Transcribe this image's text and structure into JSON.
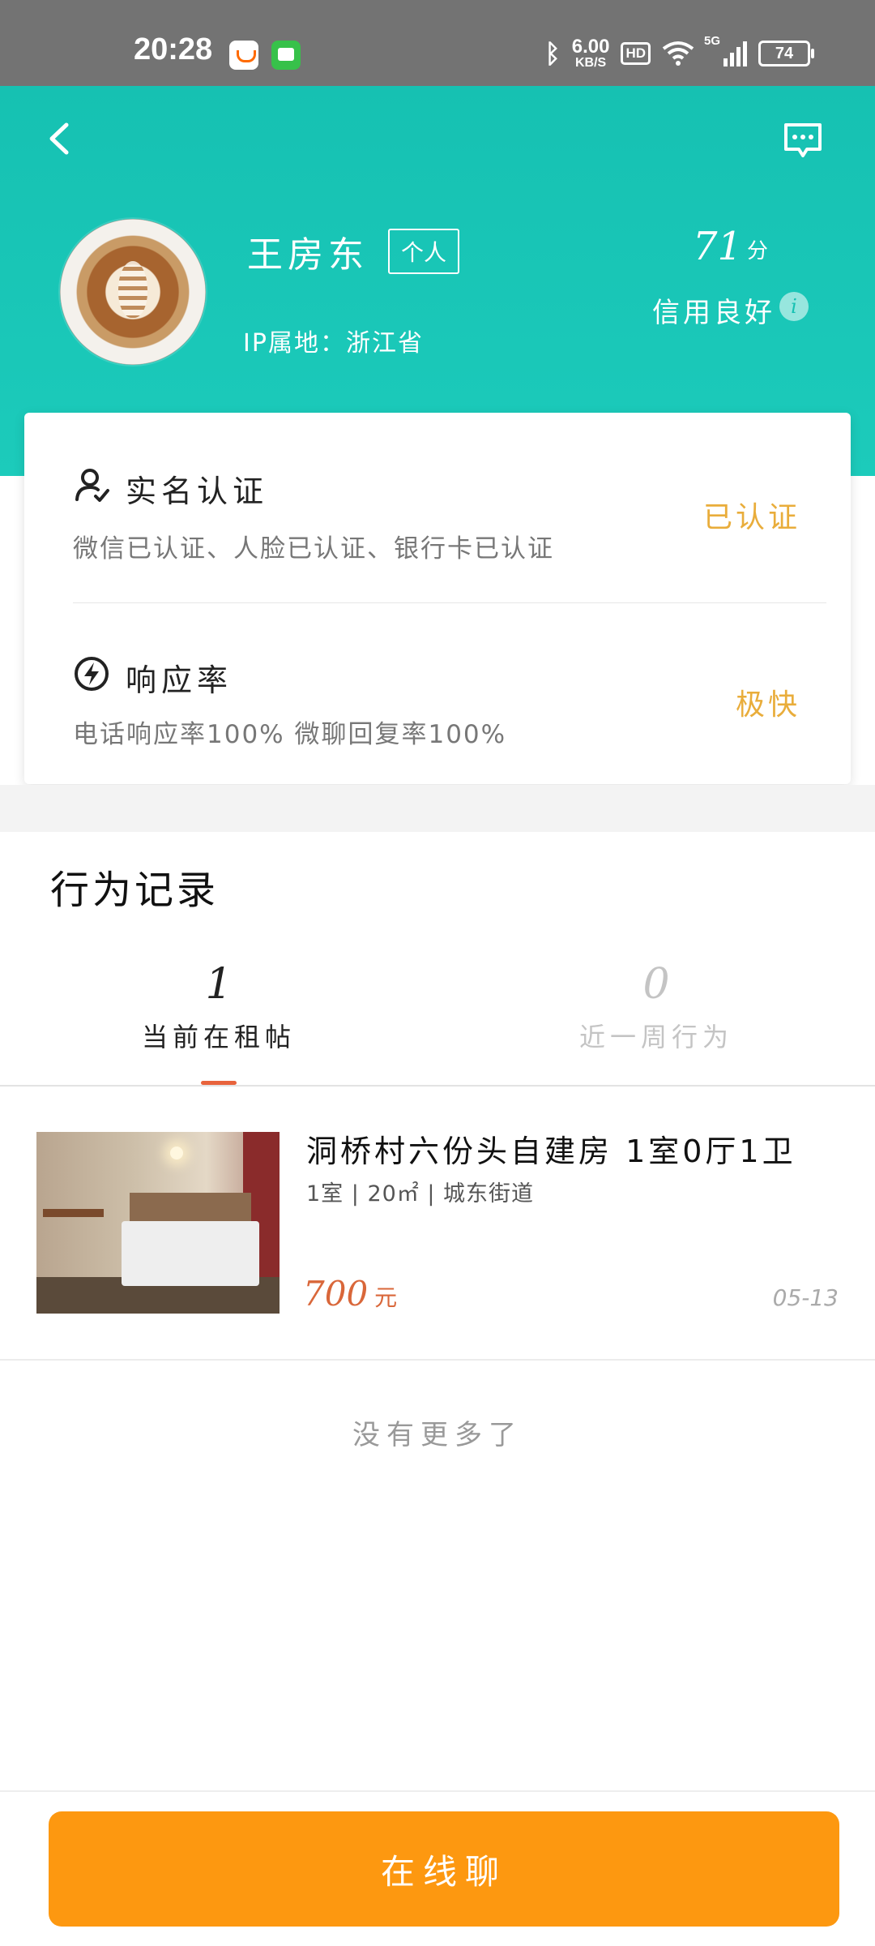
{
  "status_bar": {
    "time": "20:28",
    "net_speed_value": "6.00",
    "net_speed_unit": "KB/S",
    "hd_label": "HD",
    "network_label": "5G",
    "battery": "74"
  },
  "header": {
    "name": "王房东",
    "name_tag": "个人",
    "ip_location": "IP属地：浙江省",
    "score": "71",
    "score_unit": "分",
    "credit_label": "信用良好",
    "info_glyph": "i"
  },
  "verification": {
    "title": "实名认证",
    "desc": "微信已认证、人脸已认证、银行卡已认证",
    "status": "已认证"
  },
  "response": {
    "title": "响应率",
    "desc": "电话响应率100%  微聊回复率100%",
    "status": "极快"
  },
  "behavior": {
    "title": "行为记录",
    "tabs": [
      {
        "count": "1",
        "label": "当前在租帖"
      },
      {
        "count": "0",
        "label": "近一周行为"
      }
    ],
    "listing": {
      "title": "洞桥村六份头自建房 1室0厅1卫",
      "meta": "1室 | 20㎡ | 城东街道",
      "price": "700",
      "price_unit": "元",
      "date": "05-13"
    },
    "no_more": "没有更多了"
  },
  "bottom": {
    "chat_button": "在线聊"
  },
  "colors": {
    "header_teal": "#16c1b2",
    "status_orange": "#e9ad3b",
    "price_red": "#d9673a",
    "button_orange": "#fd9810"
  }
}
